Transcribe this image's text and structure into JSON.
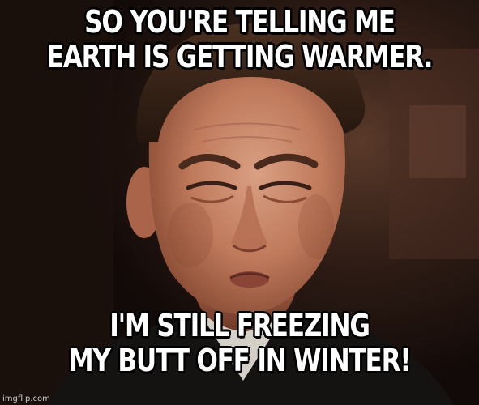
{
  "meme": {
    "top_text": {
      "line1": "SO YOU'RE TELLING ME",
      "line2": "EARTH IS GETTING WARMER."
    },
    "bottom_text": {
      "line1": "I'M STILL FREEZING",
      "line2": "MY BUTT OFF IN WINTER!"
    },
    "watermark": "imgflip.com"
  },
  "colors": {
    "caption_fill": "#ffffff",
    "caption_outline": "#000000",
    "background_dark": "#1a0f0c",
    "skin_tone": "#c7876a",
    "hair": "#3a2518",
    "suit": "#151212"
  }
}
